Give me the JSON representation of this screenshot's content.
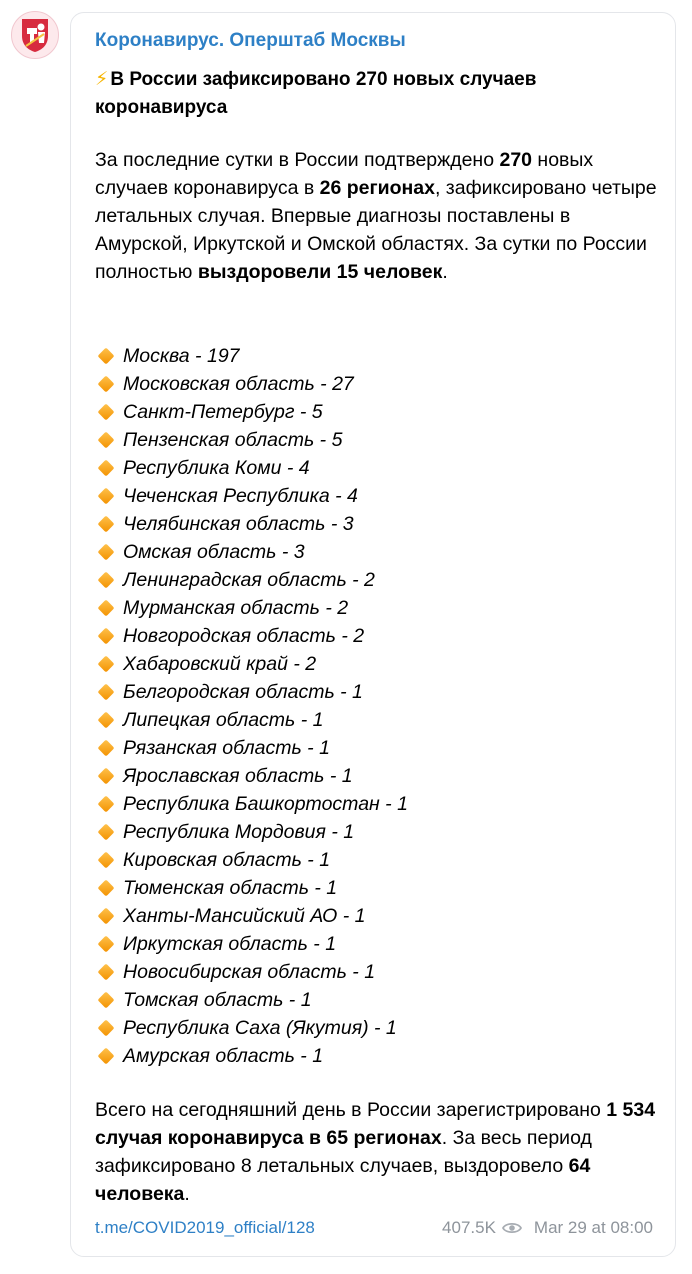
{
  "channel": {
    "name": "Коронавирус. Оперштаб Москвы"
  },
  "post": {
    "headline_icon": "⚡",
    "headline": "В России зафиксировано 270 новых случаев коронавируса",
    "intro": {
      "t1": "За последние сутки в России подтверждено ",
      "b1": "270",
      "t2": " новых случаев коронавируса в ",
      "b2": "26 регионах",
      "t3": ", зафиксировано четыре летальных случая. Впервые диагнозы поставлены в Амурской, Иркутской и Омской областях. За сутки по России полностью ",
      "b3": "выздоровели 15 человек",
      "t4": "."
    },
    "regions": [
      {
        "label": "Москва - 197"
      },
      {
        "label": "Московская область - 27"
      },
      {
        "label": "Санкт-Петербург - 5"
      },
      {
        "label": "Пензенская область - 5"
      },
      {
        "label": "Республика Коми - 4"
      },
      {
        "label": "Чеченская Республика - 4"
      },
      {
        "label": "Челябинская область - 3"
      },
      {
        "label": "Омская область - 3"
      },
      {
        "label": "Ленинградская область - 2"
      },
      {
        "label": "Мурманская область - 2"
      },
      {
        "label": "Новгородская область - 2"
      },
      {
        "label": "Хабаровский край - 2"
      },
      {
        "label": "Белгородская область - 1"
      },
      {
        "label": "Липецкая область - 1"
      },
      {
        "label": "Рязанская область - 1"
      },
      {
        "label": "Ярославская область - 1"
      },
      {
        "label": "Республика Башкортостан - 1"
      },
      {
        "label": "Республика Мордовия - 1"
      },
      {
        "label": "Кировская область - 1"
      },
      {
        "label": "Тюменская область - 1"
      },
      {
        "label": "Ханты-Мансийский АО - 1"
      },
      {
        "label": "Иркутская область - 1"
      },
      {
        "label": "Новосибирская область - 1"
      },
      {
        "label": "Томская область - 1"
      },
      {
        "label": "Республика Саха (Якутия) - 1"
      },
      {
        "label": "Амурская область - 1"
      }
    ],
    "summary": {
      "t1": "Всего на сегодняшний день в России зарегистрировано ",
      "b1": "1 534 случая коронавируса в 65 регионах",
      "t2": ". За весь период зафиксировано 8 летальных случаев, выздоровело ",
      "b2": "64 человека",
      "t3": "."
    },
    "link": "t.me/COVID2019_official/128",
    "views": "407.5K",
    "date": "Mar 29 at 08:00"
  },
  "icons": {
    "avatar": "moscow-coat-of-arms-icon",
    "bullet": "orange-diamond-icon",
    "views": "eye-icon",
    "headline": "lightning-icon"
  },
  "colors": {
    "link": "#2e80c6",
    "meta": "#8e949b",
    "bullet": "#f39200",
    "border": "#e4e6ea"
  }
}
